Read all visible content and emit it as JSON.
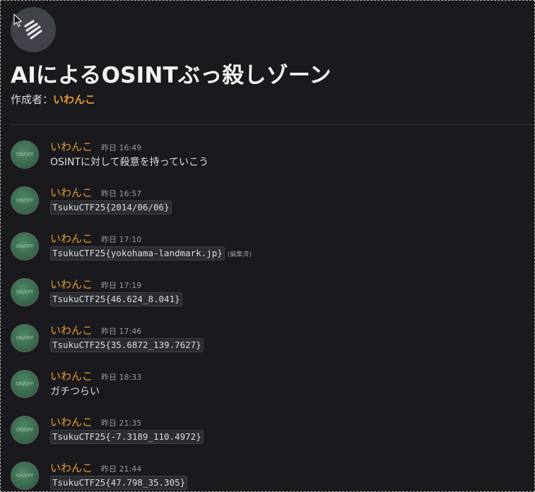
{
  "channel": {
    "title": "AIによるOSINTぶっ殺しゾーン",
    "creator_label": "作成者：",
    "creator_name": "いわんこ"
  },
  "avatar_text": "ON/OFF",
  "messages": [
    {
      "author": "いわんこ",
      "time": "昨日 16:49",
      "text": "OSINTに対して殺意を持っていこう",
      "code": "",
      "edited": ""
    },
    {
      "author": "いわんこ",
      "time": "昨日 16:57",
      "text": "",
      "code": "TsukuCTF25{2014/06/06}",
      "edited": ""
    },
    {
      "author": "いわんこ",
      "time": "昨日 17:10",
      "text": "",
      "code": "TsukuCTF25{yokohama-landmark.jp}",
      "edited": "(編集済)"
    },
    {
      "author": "いわんこ",
      "time": "昨日 17:19",
      "text": "",
      "code": "TsukuCTF25{46.624_8.041}",
      "edited": ""
    },
    {
      "author": "いわんこ",
      "time": "昨日 17:46",
      "text": "",
      "code": "TsukuCTF25{35.6872_139.7627}",
      "edited": ""
    },
    {
      "author": "いわんこ",
      "time": "昨日 18:33",
      "text": "ガチつらい",
      "code": "",
      "edited": ""
    },
    {
      "author": "いわんこ",
      "time": "昨日 21:35",
      "text": "",
      "code": "TsukuCTF25{-7.3189_110.4972}",
      "edited": ""
    },
    {
      "author": "いわんこ",
      "time": "昨日 21:44",
      "text": "",
      "code": "TsukuCTF25{47.798_35.305}",
      "edited": ""
    }
  ],
  "colors": {
    "background": "#1a1a1e",
    "author": "#e89a2c",
    "timestamp": "#949ba4",
    "text": "#dbdee1"
  },
  "icons": {
    "cursor": "mouse-pointer-icon",
    "channel": "thread-channel-icon"
  }
}
